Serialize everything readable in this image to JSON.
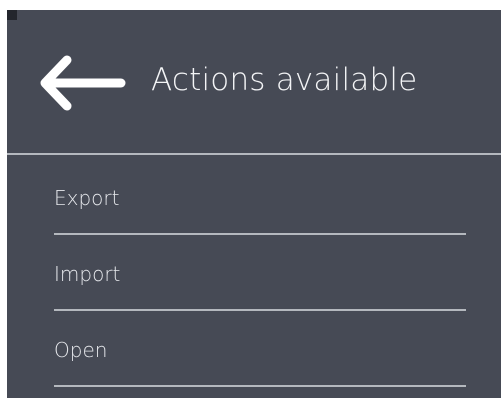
{
  "header": {
    "back_icon": "arrow-left-icon",
    "title": "Actions available"
  },
  "menu": {
    "items": [
      {
        "label": "Export"
      },
      {
        "label": "Import"
      },
      {
        "label": "Open"
      }
    ]
  },
  "colors": {
    "panel_background": "#464a55",
    "text": "#f3f4f6",
    "divider": "#c8cbd1"
  }
}
